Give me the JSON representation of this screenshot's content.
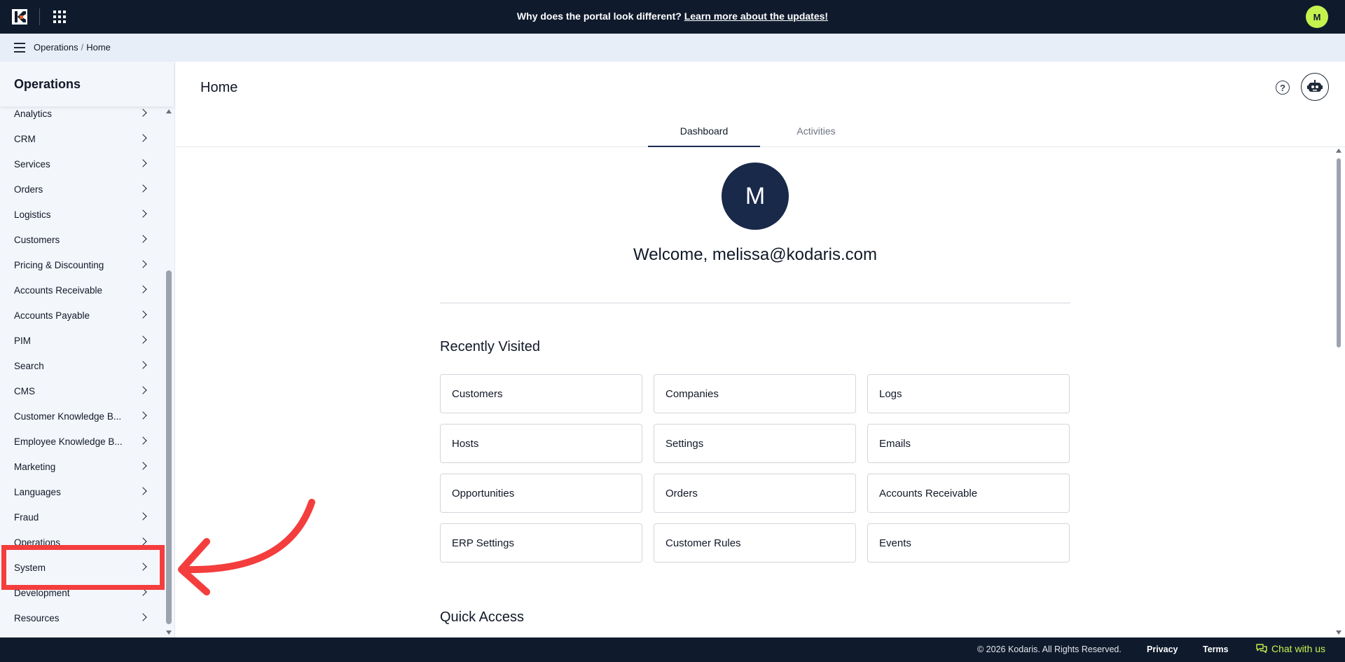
{
  "topbar": {
    "logo_icon": "kodaris-logo-icon",
    "apps_icon": "app-grid-icon",
    "announcement_text": "Why does the portal look different?",
    "announcement_link": "Learn more about the updates!",
    "user_initial": "M",
    "user_avatar_color": "#c6f24e"
  },
  "breadcrumb": {
    "items": [
      "Operations",
      "Home"
    ],
    "separator": "/"
  },
  "sidebar": {
    "title": "Operations",
    "items": [
      {
        "label": "Analytics"
      },
      {
        "label": "CRM"
      },
      {
        "label": "Services"
      },
      {
        "label": "Orders"
      },
      {
        "label": "Logistics"
      },
      {
        "label": "Customers"
      },
      {
        "label": "Pricing & Discounting"
      },
      {
        "label": "Accounts Receivable"
      },
      {
        "label": "Accounts Payable"
      },
      {
        "label": "PIM"
      },
      {
        "label": "Search"
      },
      {
        "label": "CMS"
      },
      {
        "label": "Customer Knowledge B..."
      },
      {
        "label": "Employee Knowledge B..."
      },
      {
        "label": "Marketing"
      },
      {
        "label": "Languages"
      },
      {
        "label": "Fraud"
      },
      {
        "label": "Operations"
      },
      {
        "label": "System"
      },
      {
        "label": "Development"
      },
      {
        "label": "Resources"
      }
    ],
    "highlighted_item": "System",
    "highlight_color": "#f43d3d"
  },
  "main": {
    "title": "Home",
    "help_icon": "help-circle-icon",
    "assistant_icon": "robot-icon",
    "tabs": [
      {
        "label": "Dashboard",
        "active": true
      },
      {
        "label": "Activities",
        "active": false
      }
    ],
    "avatar_initial": "M",
    "avatar_color": "#19294a",
    "welcome_text": "Welcome, melissa@kodaris.com",
    "recently_visited_title": "Recently Visited",
    "recently_visited": [
      [
        "Customers",
        "Companies",
        "Logs"
      ],
      [
        "Hosts",
        "Settings",
        "Emails"
      ],
      [
        "Opportunities",
        "Orders",
        "Accounts Receivable"
      ],
      [
        "ERP Settings",
        "Customer Rules",
        "Events"
      ]
    ],
    "quick_access_title": "Quick Access"
  },
  "footer": {
    "copyright": "© 2026 Kodaris. All Rights Reserved.",
    "privacy": "Privacy",
    "terms": "Terms",
    "chat": "Chat with us",
    "chat_icon": "chat-bubbles-icon",
    "accent_color": "#c6f24e"
  }
}
